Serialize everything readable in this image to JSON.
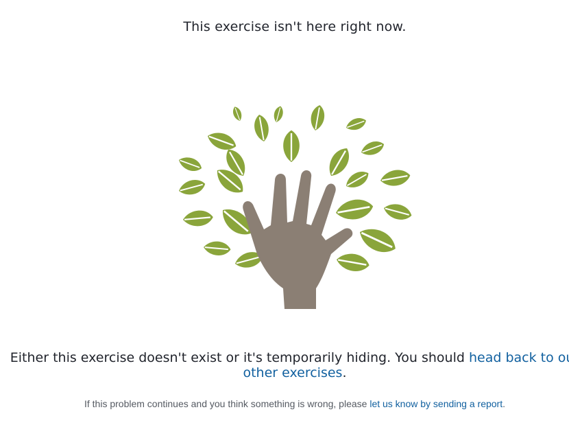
{
  "heading": "This exercise isn't here right now.",
  "illustration": {
    "icon": "hand-tree-icon",
    "leaf_color": "#8aa53b",
    "hand_color": "#8b7f74"
  },
  "message": {
    "text_before": "Either this exercise doesn't exist or it's temporarily hiding. You should ",
    "link_label": "head back to our other exercises",
    "text_after": "."
  },
  "report": {
    "text_before": "If this problem continues and you think something is wrong, please ",
    "link_label": "let us know by sending a report",
    "text_after": "."
  },
  "colors": {
    "link": "#11609f",
    "text": "#21242c",
    "muted": "#555a62"
  }
}
